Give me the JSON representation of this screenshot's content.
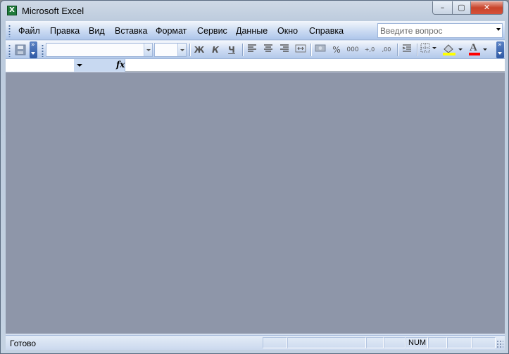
{
  "window": {
    "title": "Microsoft Excel",
    "app_icon": "excel-icon",
    "close_glyph": "✕",
    "maximize_glyph": "▢",
    "minimize_glyph": "–"
  },
  "menu": {
    "items": [
      {
        "label": "Файл"
      },
      {
        "label": "Правка"
      },
      {
        "label": "Вид"
      },
      {
        "label": "Вставка"
      },
      {
        "label": "Формат"
      },
      {
        "label": "Сервис"
      },
      {
        "label": "Данные"
      },
      {
        "label": "Окно"
      },
      {
        "label": "Справка"
      }
    ],
    "help_placeholder": "Введите вопрос"
  },
  "toolbar": {
    "bold": "Ж",
    "italic": "К",
    "underline": "Ч",
    "percent": "%",
    "thousands": "000",
    "inc_decimal": "+,0",
    "dec_decimal": ",00",
    "font_color_letter": "A"
  },
  "formula_bar": {
    "fx_label": "fx"
  },
  "statusbar": {
    "status": "Готово",
    "num_indicator": "NUM"
  },
  "colors": {
    "workspace": "#8e96a9",
    "fill_color": "#ffff00",
    "font_color": "#ff0000"
  }
}
